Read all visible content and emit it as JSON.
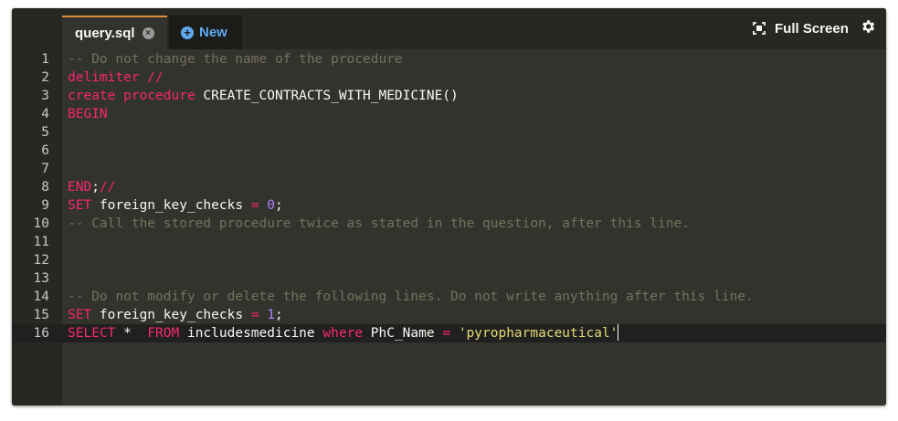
{
  "tabs": {
    "active_label": "query.sql",
    "close_glyph": "×",
    "new_label": "New",
    "new_icon_glyph": "+"
  },
  "toolbar": {
    "fullscreen_label": "Full Screen"
  },
  "code_lines": [
    {
      "n": "1",
      "tokens": [
        {
          "t": "comment",
          "v": "-- Do not change the name of the procedure"
        }
      ]
    },
    {
      "n": "2",
      "tokens": [
        {
          "t": "kw",
          "v": "delimiter //"
        }
      ]
    },
    {
      "n": "3",
      "tokens": [
        {
          "t": "kw",
          "v": "create procedure"
        },
        {
          "t": "plain",
          "v": " CREATE_CONTRACTS_WITH_MEDICINE()"
        }
      ]
    },
    {
      "n": "4",
      "tokens": [
        {
          "t": "kw",
          "v": "BEGIN"
        }
      ]
    },
    {
      "n": "5",
      "tokens": []
    },
    {
      "n": "6",
      "tokens": []
    },
    {
      "n": "7",
      "tokens": []
    },
    {
      "n": "8",
      "tokens": [
        {
          "t": "kw",
          "v": "END"
        },
        {
          "t": "plain",
          "v": ";"
        },
        {
          "t": "kw",
          "v": "//"
        }
      ]
    },
    {
      "n": "9",
      "tokens": [
        {
          "t": "kw",
          "v": "SET"
        },
        {
          "t": "plain",
          "v": " foreign_key_checks "
        },
        {
          "t": "kw",
          "v": "="
        },
        {
          "t": "plain",
          "v": " "
        },
        {
          "t": "num",
          "v": "0"
        },
        {
          "t": "plain",
          "v": ";"
        }
      ]
    },
    {
      "n": "10",
      "tokens": [
        {
          "t": "comment",
          "v": "-- Call the stored procedure twice as stated in the question, after this line."
        }
      ]
    },
    {
      "n": "11",
      "tokens": []
    },
    {
      "n": "12",
      "tokens": []
    },
    {
      "n": "13",
      "tokens": []
    },
    {
      "n": "14",
      "tokens": [
        {
          "t": "comment",
          "v": "-- Do not modify or delete the following lines. Do not write anything after this line."
        }
      ]
    },
    {
      "n": "15",
      "tokens": [
        {
          "t": "kw",
          "v": "SET"
        },
        {
          "t": "plain",
          "v": " foreign_key_checks "
        },
        {
          "t": "kw",
          "v": "="
        },
        {
          "t": "plain",
          "v": " "
        },
        {
          "t": "num",
          "v": "1"
        },
        {
          "t": "plain",
          "v": ";"
        }
      ]
    },
    {
      "n": "16",
      "active": true,
      "cursor": true,
      "tokens": [
        {
          "t": "kw",
          "v": "SELECT"
        },
        {
          "t": "plain",
          "v": " *  "
        },
        {
          "t": "kw",
          "v": "FROM"
        },
        {
          "t": "plain",
          "v": " includesmedicine "
        },
        {
          "t": "kw",
          "v": "where"
        },
        {
          "t": "plain",
          "v": " PhC_Name "
        },
        {
          "t": "kw",
          "v": "="
        },
        {
          "t": "plain",
          "v": " "
        },
        {
          "t": "str",
          "v": "'pyropharmaceutical'"
        }
      ]
    }
  ],
  "colors": {
    "background": "#272822",
    "comment": "#75715e",
    "keyword": "#f92672",
    "number": "#ae81ff",
    "string": "#e6db74",
    "tab_accent": "#e0893b",
    "new_tab_text": "#5fa9ef"
  }
}
